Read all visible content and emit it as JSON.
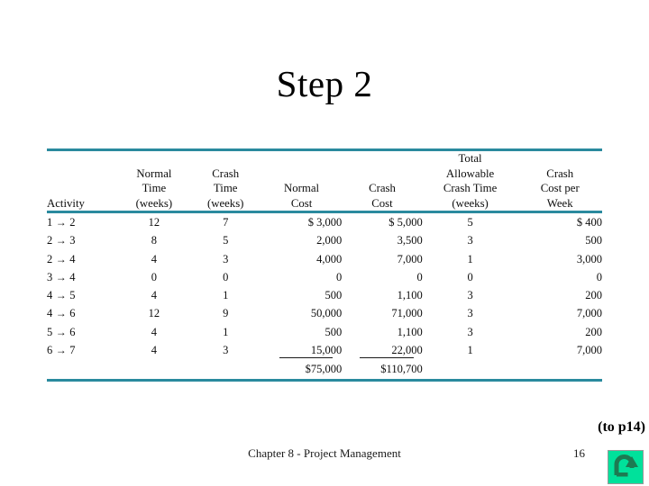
{
  "slide": {
    "title": "Step 2",
    "accent_color": "#2a8a9e",
    "background_color": "#ffffff"
  },
  "table": {
    "headers": {
      "activity": "Activity",
      "normal_time": [
        "Normal",
        "Time",
        "(weeks)"
      ],
      "crash_time": [
        "Crash",
        "Time",
        "(weeks)"
      ],
      "normal_cost": [
        "Normal",
        "Cost"
      ],
      "crash_cost": [
        "Crash",
        "Cost"
      ],
      "total_allowable_crash_time": [
        "Total",
        "Allowable",
        "Crash Time",
        "(weeks)"
      ],
      "crash_cost_per_week": [
        "Crash",
        "Cost per",
        "Week"
      ]
    },
    "rows": [
      {
        "from": "1",
        "to": "2",
        "normal_time": "12",
        "crash_time": "7",
        "normal_cost": "$ 3,000",
        "crash_cost": "$ 5,000",
        "allowable": "5",
        "cost_per_week": "$ 400"
      },
      {
        "from": "2",
        "to": "3",
        "normal_time": "8",
        "crash_time": "5",
        "normal_cost": "2,000",
        "crash_cost": "3,500",
        "allowable": "3",
        "cost_per_week": "500"
      },
      {
        "from": "2",
        "to": "4",
        "normal_time": "4",
        "crash_time": "3",
        "normal_cost": "4,000",
        "crash_cost": "7,000",
        "allowable": "1",
        "cost_per_week": "3,000"
      },
      {
        "from": "3",
        "to": "4",
        "normal_time": "0",
        "crash_time": "0",
        "normal_cost": "0",
        "crash_cost": "0",
        "allowable": "0",
        "cost_per_week": "0"
      },
      {
        "from": "4",
        "to": "5",
        "normal_time": "4",
        "crash_time": "1",
        "normal_cost": "500",
        "crash_cost": "1,100",
        "allowable": "3",
        "cost_per_week": "200"
      },
      {
        "from": "4",
        "to": "6",
        "normal_time": "12",
        "crash_time": "9",
        "normal_cost": "50,000",
        "crash_cost": "71,000",
        "allowable": "3",
        "cost_per_week": "7,000"
      },
      {
        "from": "5",
        "to": "6",
        "normal_time": "4",
        "crash_time": "1",
        "normal_cost": "500",
        "crash_cost": "1,100",
        "allowable": "3",
        "cost_per_week": "200"
      },
      {
        "from": "6",
        "to": "7",
        "normal_time": "4",
        "crash_time": "3",
        "normal_cost": "15,000",
        "crash_cost": "22,000",
        "allowable": "1",
        "cost_per_week": "7,000"
      }
    ],
    "totals": {
      "normal_cost": "$75,000",
      "crash_cost": "$110,700"
    },
    "arrow_glyph": "→"
  },
  "reference_note": "(to p14)",
  "footer": {
    "text": "Chapter 8 - Project Management",
    "page_number": "16"
  },
  "return_button": {
    "icon": "u-turn-arrow-icon",
    "fill_color": "#00e19b",
    "arrow_color": "#1d7a52"
  }
}
